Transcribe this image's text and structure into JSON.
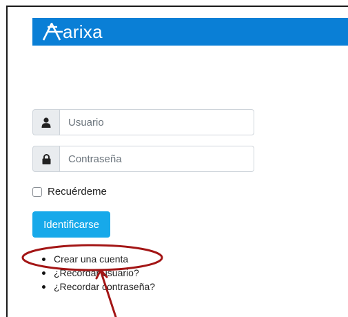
{
  "brand": {
    "logo_text": "arixa",
    "bar_color": "#0a7fd6"
  },
  "login_form": {
    "username": {
      "placeholder": "Usuario",
      "icon": "user-icon",
      "value": ""
    },
    "password": {
      "placeholder": "Contraseña",
      "icon": "lock-icon",
      "value": ""
    },
    "remember_label": "Recuérdeme",
    "remember_checked": false,
    "submit_label": "Identificarse",
    "submit_color": "#17a9ea"
  },
  "links": [
    {
      "label": "Crear una cuenta"
    },
    {
      "label": "¿Recordar usuario?"
    },
    {
      "label": "¿Recordar contraseña?"
    }
  ],
  "annotation": {
    "color": "#a31515",
    "shape": "ellipse-with-arrow",
    "highlights": "Crear una cuenta"
  }
}
